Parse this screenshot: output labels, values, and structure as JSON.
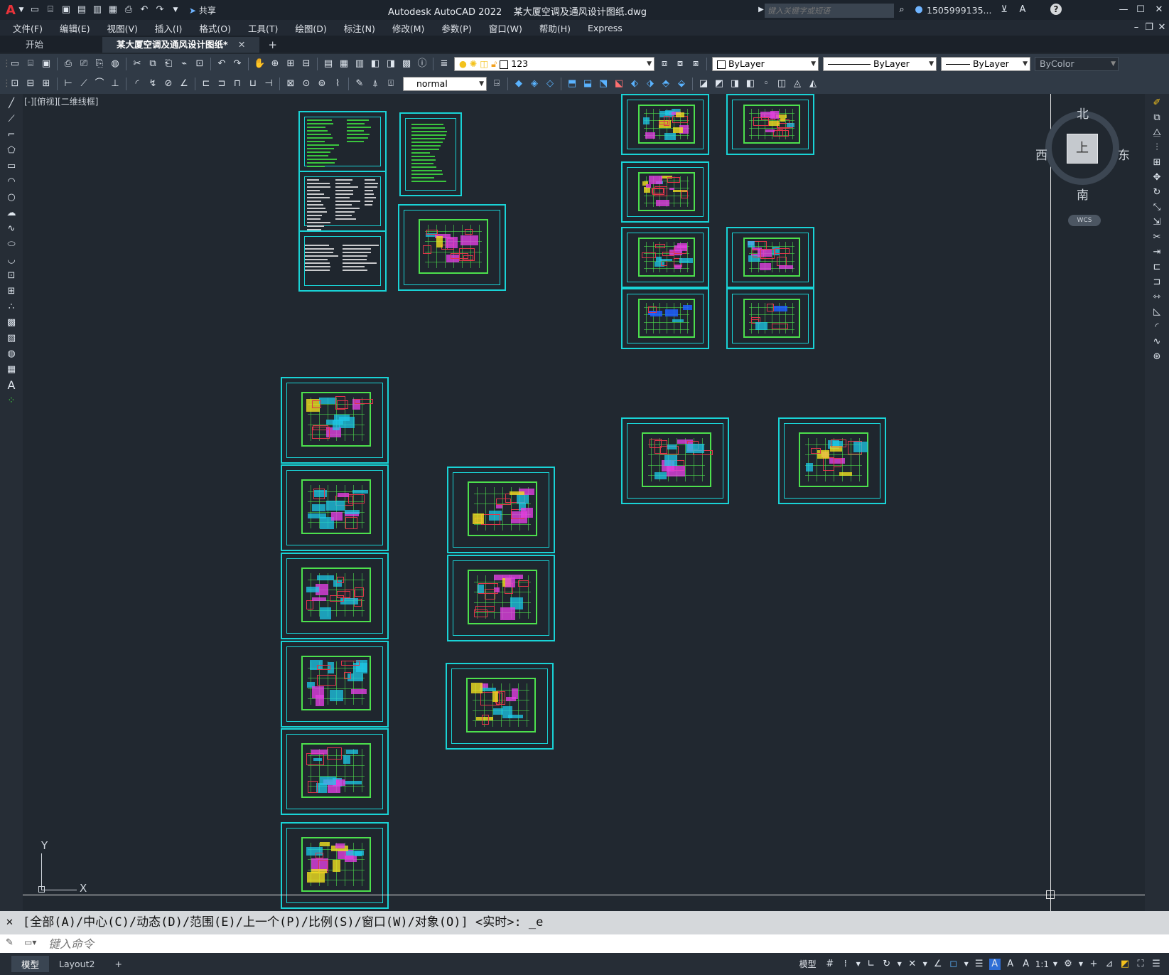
{
  "titlebar": {
    "app_icon": "A",
    "share_label": "共享",
    "title": "Autodesk AutoCAD 2022    某大厦空调及通风设计图纸.dwg",
    "search_placeholder": "键入关键字或短语",
    "user": "1505999135...",
    "help": "?"
  },
  "menu": [
    "文件(F)",
    "编辑(E)",
    "视图(V)",
    "插入(I)",
    "格式(O)",
    "工具(T)",
    "绘图(D)",
    "标注(N)",
    "修改(M)",
    "参数(P)",
    "窗口(W)",
    "帮助(H)",
    "Express"
  ],
  "tabs": {
    "start": "开始",
    "doc": "某大厦空调及通风设计图纸*",
    "add": "+"
  },
  "layer": {
    "name": "123"
  },
  "props": {
    "color": "ByLayer",
    "linetype": "ByLayer",
    "lineweight": "ByLayer",
    "plotstyle": "ByColor"
  },
  "style": {
    "text_style": "normal"
  },
  "viewport": {
    "label": "[-][俯视][二维线框]"
  },
  "viewcube": {
    "north": "北",
    "south": "南",
    "east": "东",
    "west": "西",
    "face": "上",
    "wcs": "WCS"
  },
  "ucs": {
    "x": "X",
    "y": "Y"
  },
  "command": {
    "history": "[全部(A)/中心(C)/动态(D)/范围(E)/上一个(P)/比例(S)/窗口(W)/对象(O)] <实时>: _e",
    "placeholder": "键入命令"
  },
  "layouts": [
    "模型",
    "Layout2",
    "+"
  ],
  "status": {
    "model": "模型",
    "scale": "1:1"
  }
}
